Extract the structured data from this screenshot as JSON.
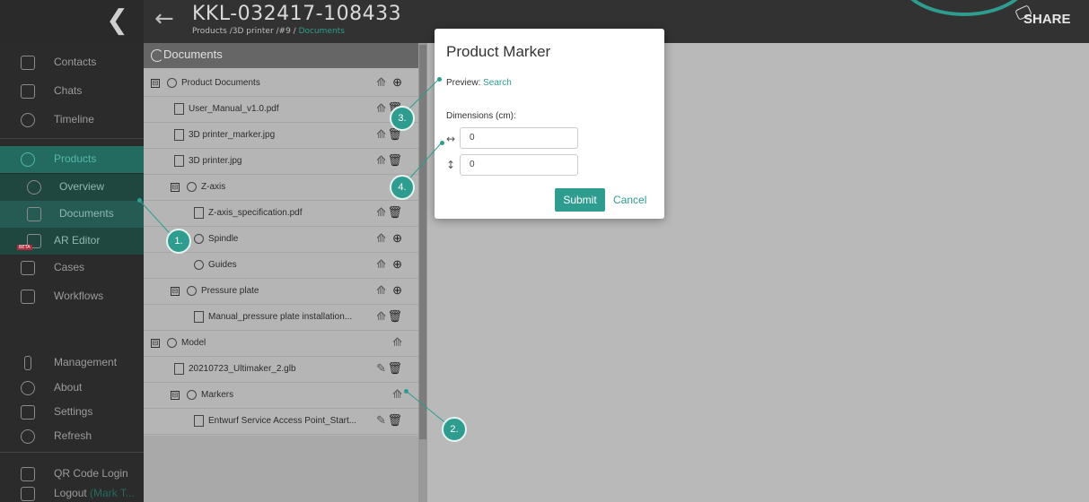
{
  "header": {
    "collapse_glyph": "❮",
    "back_glyph": "←",
    "title": "KKL-032417-108433",
    "breadcrumb_prefix": "Products /3D printer /#9 / ",
    "breadcrumb_current": "Documents",
    "share_label": "SHARE"
  },
  "sidebar": {
    "items": [
      {
        "label": "Contacts",
        "icon": "contacts-icon"
      },
      {
        "label": "Chats",
        "icon": "chat-icon"
      },
      {
        "label": "Timeline",
        "icon": "clock-icon"
      },
      {
        "label": "Products",
        "icon": "product-icon"
      },
      {
        "label": "Overview",
        "icon": "overview-icon"
      },
      {
        "label": "Documents",
        "icon": "document-icon"
      },
      {
        "label": "AR Editor",
        "icon": "ar-editor-icon",
        "badge": "BETA"
      },
      {
        "label": "Cases",
        "icon": "cases-icon"
      },
      {
        "label": "Workflows",
        "icon": "workflow-icon"
      },
      {
        "label": "Management",
        "icon": "management-icon"
      },
      {
        "label": "About",
        "icon": "info-icon"
      },
      {
        "label": "Settings",
        "icon": "settings-icon"
      },
      {
        "label": "Refresh",
        "icon": "refresh-icon"
      },
      {
        "label": "QR Code Login",
        "icon": "qr-icon"
      }
    ],
    "logout_label": "Logout",
    "logout_user": "(Mark T..."
  },
  "documents": {
    "title": "Documents",
    "rows": [
      {
        "label": "Product Documents",
        "kind": "folder",
        "toggle": "⊟",
        "actions": [
          "upload-icon",
          "add-icon"
        ]
      },
      {
        "label": "User_Manual_v1.0.pdf",
        "kind": "pdf",
        "actions": [
          "upload-icon",
          "delete-icon"
        ]
      },
      {
        "label": "3D printer_marker.jpg",
        "kind": "image",
        "actions": [
          "upload-icon",
          "delete-icon"
        ]
      },
      {
        "label": "3D printer.jpg",
        "kind": "image",
        "actions": [
          "upload-icon",
          "delete-icon"
        ]
      },
      {
        "label": "Z-axis",
        "kind": "folder",
        "toggle": "⊟",
        "actions": [
          "upload-icon"
        ]
      },
      {
        "label": "Z-axis_specification.pdf",
        "kind": "pdf",
        "actions": [
          "upload-icon",
          "delete-icon"
        ]
      },
      {
        "label": "Spindle",
        "kind": "folder",
        "actions": [
          "upload-icon",
          "add-icon"
        ]
      },
      {
        "label": "Guides",
        "kind": "folder",
        "actions": [
          "upload-icon",
          "add-icon"
        ]
      },
      {
        "label": "Pressure plate",
        "kind": "folder",
        "toggle": "⊟",
        "actions": [
          "upload-icon",
          "add-icon"
        ]
      },
      {
        "label": "Manual_pressure plate installation...",
        "kind": "pdf",
        "actions": [
          "upload-icon",
          "delete-icon"
        ]
      },
      {
        "label": "Model",
        "kind": "folder",
        "toggle": "⊟",
        "actions": [
          "upload-icon"
        ]
      },
      {
        "label": "20210723_Ultimaker_2.glb",
        "kind": "model",
        "actions": [
          "edit-icon",
          "delete-icon"
        ]
      },
      {
        "label": "Markers",
        "kind": "folder",
        "toggle": "⊟",
        "actions": [
          "upload-icon"
        ]
      },
      {
        "label": "Entwurf Service Access Point_Start...",
        "kind": "model",
        "actions": [
          "edit-icon",
          "delete-icon"
        ]
      }
    ]
  },
  "modal": {
    "title": "Product Marker",
    "preview_label": "Preview: ",
    "preview_link": "Search",
    "dimensions_label": "Dimensions (cm):",
    "width_glyph": "↔",
    "height_glyph": "↕",
    "width_value": "0",
    "height_value": "0",
    "submit_label": "Submit",
    "cancel_label": "Cancel"
  },
  "callouts": [
    "1.",
    "2.",
    "3.",
    "4."
  ],
  "colors": {
    "accent": "#2e9c8e",
    "sidebar": "#2b2b2b",
    "topbar": "#323232"
  }
}
